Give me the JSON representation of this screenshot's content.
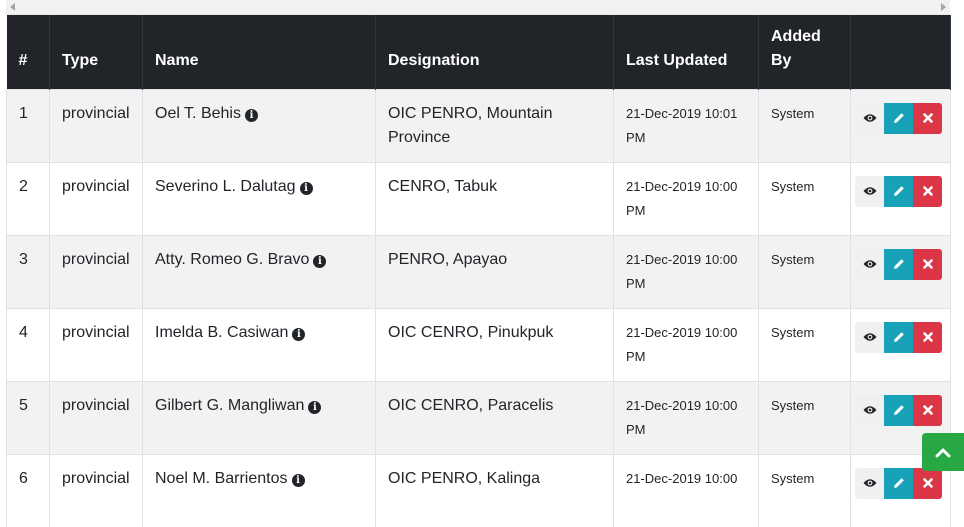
{
  "table": {
    "headers": {
      "num": "#",
      "type": "Type",
      "name": "Name",
      "designation": "Designation",
      "last_updated": "Last Updated",
      "added_by": "Added By",
      "actions": ""
    },
    "rows": [
      {
        "num": "1",
        "type": "provincial",
        "name": "Oel T. Behis",
        "designation": "OIC PENRO, Mountain Province",
        "last_updated": "21-Dec-2019 10:01 PM",
        "added_by": "System"
      },
      {
        "num": "2",
        "type": "provincial",
        "name": "Severino L. Dalutag",
        "designation": "CENRO, Tabuk",
        "last_updated": "21-Dec-2019 10:00 PM",
        "added_by": "System"
      },
      {
        "num": "3",
        "type": "provincial",
        "name": "Atty. Romeo G. Bravo",
        "designation": "PENRO, Apayao",
        "last_updated": "21-Dec-2019 10:00 PM",
        "added_by": "System"
      },
      {
        "num": "4",
        "type": "provincial",
        "name": "Imelda B. Casiwan",
        "designation": "OIC CENRO, Pinukpuk",
        "last_updated": "21-Dec-2019 10:00 PM",
        "added_by": "System"
      },
      {
        "num": "5",
        "type": "provincial",
        "name": "Gilbert G. Mangliwan",
        "designation": "OIC CENRO, Paracelis",
        "last_updated": "21-Dec-2019 10:00 PM",
        "added_by": "System"
      },
      {
        "num": "6",
        "type": "provincial",
        "name": "Noel M. Barrientos",
        "designation": "OIC PENRO, Kalinga",
        "last_updated": "21-Dec-2019 10:00",
        "added_by": "System"
      }
    ]
  },
  "icons": {
    "info": "info-circle-icon",
    "view": "eye-icon",
    "edit": "pencil-icon",
    "delete": "times-icon",
    "scroll_top": "chevron-up-icon"
  },
  "colors": {
    "header_bg": "#212529",
    "edit_button": "#17a2b8",
    "delete_button": "#dc3545",
    "scroll_top_button": "#28a745"
  }
}
